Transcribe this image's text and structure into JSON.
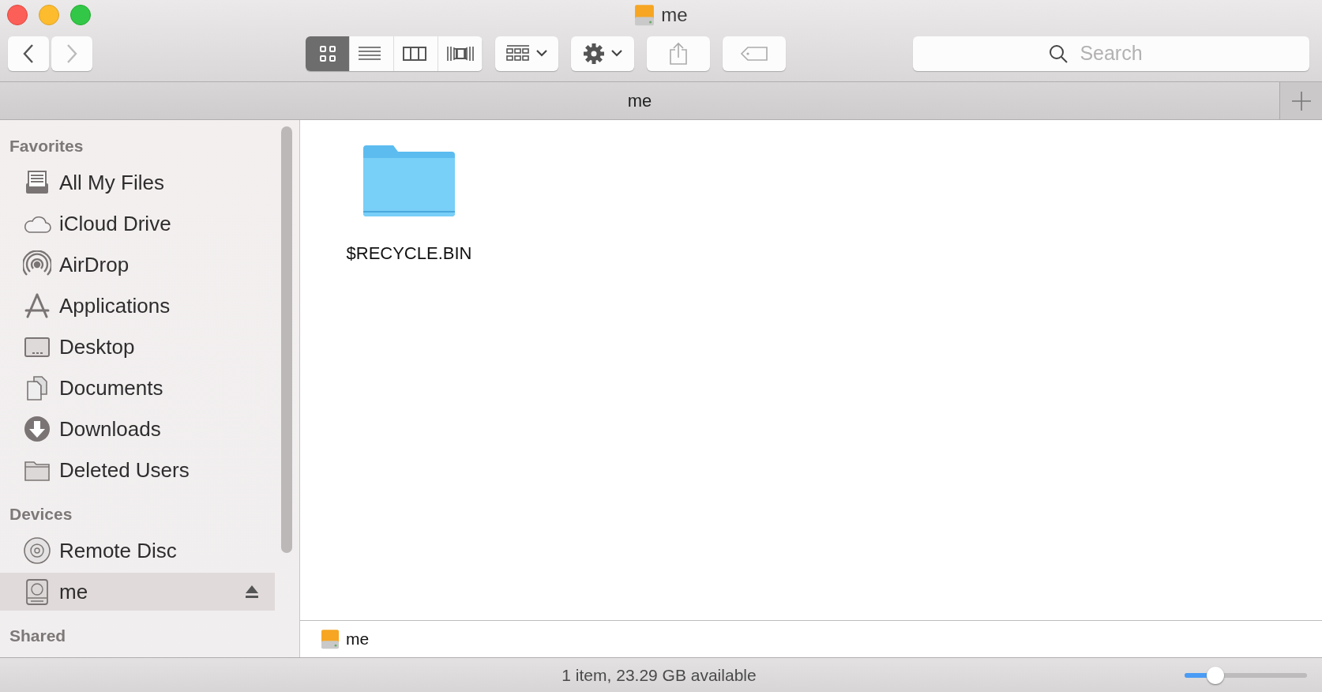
{
  "window": {
    "title": "me"
  },
  "toolbar": {
    "view_modes": [
      {
        "kind": "icons",
        "selected": true
      },
      {
        "kind": "list",
        "selected": false
      },
      {
        "kind": "columns",
        "selected": false
      },
      {
        "kind": "coverflow",
        "selected": false
      }
    ],
    "search": {
      "placeholder": "Search"
    }
  },
  "tab": {
    "label": "me"
  },
  "sidebar": {
    "sections": [
      {
        "title": "Favorites",
        "items": [
          {
            "label": "All My Files",
            "kind": "allfiles",
            "selected": false,
            "ejectable": false
          },
          {
            "label": "iCloud Drive",
            "kind": "cloud",
            "selected": false,
            "ejectable": false
          },
          {
            "label": "AirDrop",
            "kind": "airdrop",
            "selected": false,
            "ejectable": false
          },
          {
            "label": "Applications",
            "kind": "apps",
            "selected": false,
            "ejectable": false
          },
          {
            "label": "Desktop",
            "kind": "desktop",
            "selected": false,
            "ejectable": false
          },
          {
            "label": "Documents",
            "kind": "documents",
            "selected": false,
            "ejectable": false
          },
          {
            "label": "Downloads",
            "kind": "downloads",
            "selected": false,
            "ejectable": false
          },
          {
            "label": "Deleted Users",
            "kind": "folder",
            "selected": false,
            "ejectable": false
          }
        ]
      },
      {
        "title": "Devices",
        "items": [
          {
            "label": "Remote Disc",
            "kind": "disc",
            "selected": false,
            "ejectable": false
          },
          {
            "label": "me",
            "kind": "drive",
            "selected": true,
            "ejectable": true
          }
        ]
      },
      {
        "title": "Shared"
      }
    ]
  },
  "files": [
    {
      "name": "$RECYCLE.BIN"
    }
  ],
  "path_bar": {
    "label": "me"
  },
  "status_bar": {
    "text": "1 item, 23.29 GB available",
    "zoom": {
      "level": 0.25
    }
  }
}
